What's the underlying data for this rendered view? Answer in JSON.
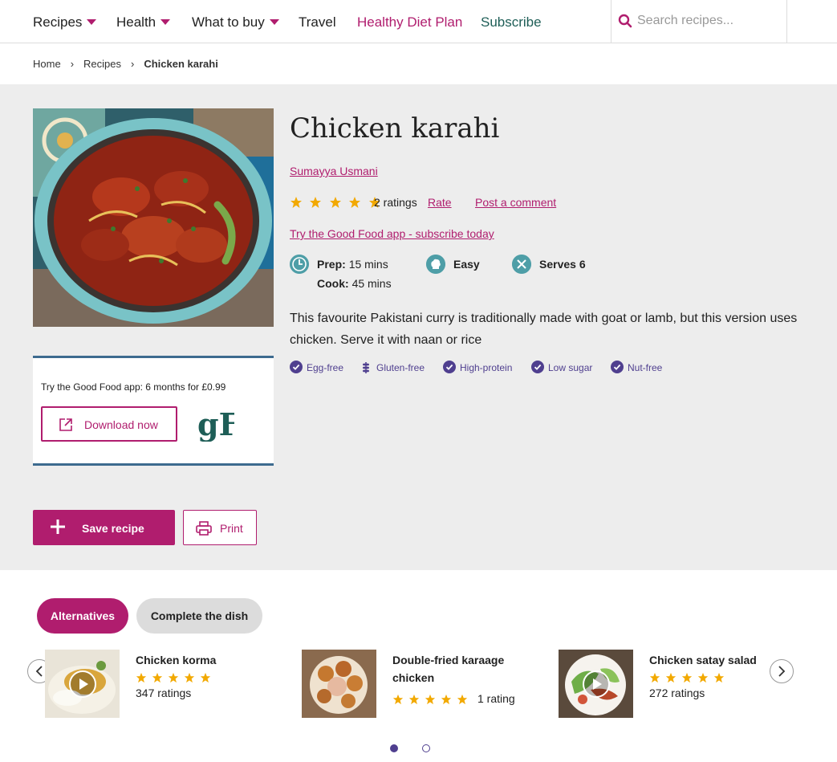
{
  "nav": {
    "items": [
      {
        "label": "Recipes"
      },
      {
        "label": "Health"
      },
      {
        "label": "What to buy"
      },
      {
        "label": "Travel"
      },
      {
        "label": "Healthy Diet Plan"
      },
      {
        "label": "Subscribe"
      }
    ],
    "search_placeholder": "Search recipes..."
  },
  "breadcrumb": {
    "items": [
      "Home",
      "Recipes",
      "Chicken karahi"
    ],
    "separator": "›"
  },
  "recipe": {
    "title": "Chicken karahi",
    "author": "Sumayya Usmani",
    "rating_stars": 5,
    "ratings_count": "2 ratings",
    "rate_label": "Rate",
    "comment_label": "Post a comment",
    "app_link": "Try the Good Food app - subscribe today",
    "prep_label": "Prep:",
    "prep_value": "15 mins",
    "cook_label": "Cook:",
    "cook_value": "45 mins",
    "difficulty": "Easy",
    "serves": "Serves 6",
    "description": "This favourite Pakistani curry is traditionally made with goat or lamb, but this version uses chicken. Serve it with naan or rice",
    "diets": [
      "Egg-free",
      "Gluten-free",
      "High-protein",
      "Low sugar",
      "Nut-free"
    ]
  },
  "app_card": {
    "text": "Try the Good Food app: 6 months for £0.99",
    "button": "Download now",
    "logo": "gF"
  },
  "actions": {
    "save": "Save recipe",
    "print": "Print"
  },
  "tabs": [
    "Alternatives",
    "Complete the dish"
  ],
  "cards": [
    {
      "name": "Chicken korma",
      "stars": 5,
      "count": "347 ratings",
      "has_video": true
    },
    {
      "name": "Double-fried karaage chicken",
      "stars": 5,
      "count": "1 rating",
      "has_video": false
    },
    {
      "name": "Chicken satay salad",
      "stars": 5,
      "count": "272 ratings",
      "has_video": true
    }
  ],
  "carousel": {
    "pages": 2,
    "current": 1
  },
  "colors": {
    "brand_pink": "#b01d6e",
    "brand_green": "#1e5e57",
    "star_gold": "#f2a900",
    "diet_purple": "#4f3f8f",
    "meta_teal": "#4e9ea7",
    "band_grey": "#ededed"
  }
}
